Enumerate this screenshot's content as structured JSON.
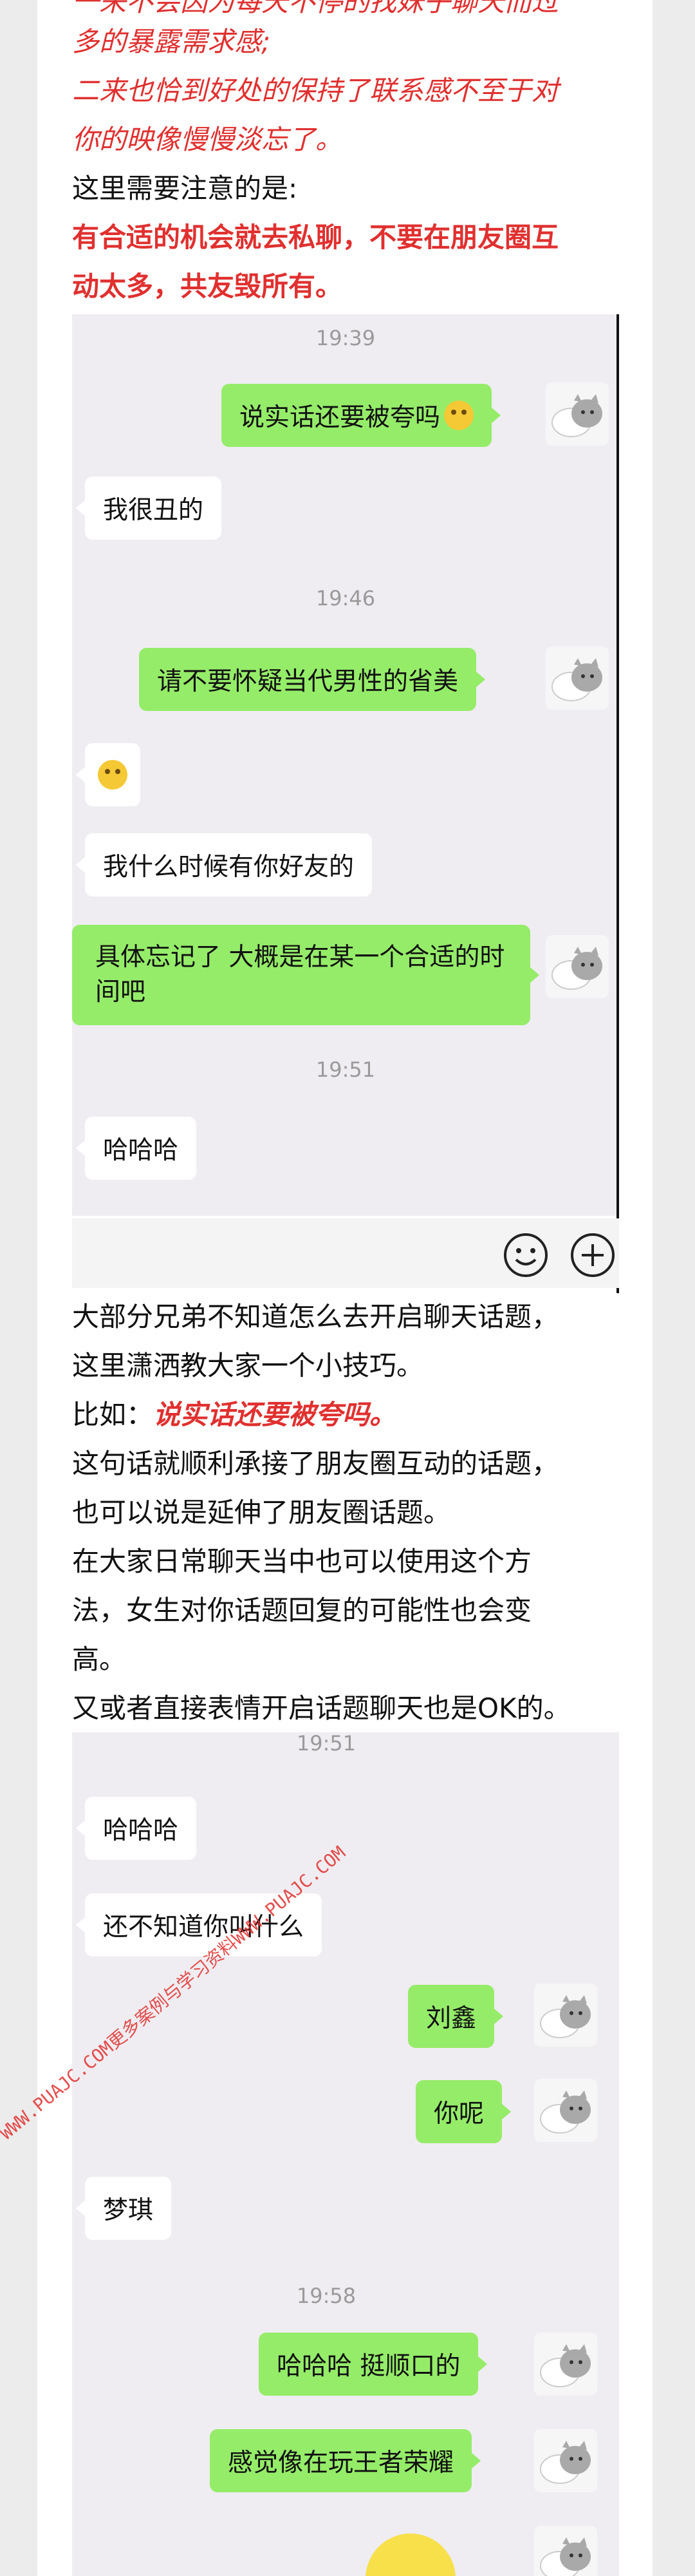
{
  "intro_lines": {
    "line1": "一来不会因为每天不停的找妹子聊天而过",
    "line2": "多的暴露需求感;",
    "line3": "二来也恰到好处的保持了联系感不至于对",
    "line4": "你的映像慢慢淡忘了。",
    "note": "这里需要注意的是:",
    "bold1": "有合适的机会就去私聊，不要在朋友圈互",
    "bold2": "动太多，共友毁所有。"
  },
  "chat1": {
    "ts1": "19:39",
    "m1": "说实话还要被夸吗",
    "m2": "我很丑的",
    "ts2": "19:46",
    "m3": "请不要怀疑当代男性的省美",
    "m5": "我什么时候有你好友的",
    "m6": "具体忘记了 大概是在某一个合适的时间吧",
    "ts3": "19:51",
    "m7": "哈哈哈"
  },
  "mid_text": {
    "p1": "大部分兄弟不知道怎么去开启聊天话题，",
    "p2": "这里潇洒教大家一个小技巧。",
    "p3_prefix": "比如：",
    "p3_quote": "说实话还要被夸吗。",
    "p4": "这句话就顺利承接了朋友圈互动的话题，",
    "p5": "也可以说是延伸了朋友圈话题。",
    "p6": "在大家日常聊天当中也可以使用这个方",
    "p7": "法，女生对你话题回复的可能性也会变",
    "p8": "高。",
    "p9": "又或者直接表情开启话题聊天也是OK的。"
  },
  "chat2": {
    "ts1": "19:51",
    "m1": "哈哈哈",
    "m2": "还不知道你叫什么",
    "m3": "刘鑫",
    "m4": "你呢",
    "m5": "梦琪",
    "ts2": "19:58",
    "m6": "哈哈哈 挺顺口的",
    "m7": "感觉像在玩王者荣耀"
  },
  "watermark": "WWW.PUAJC.COM更多案例与学习资料WWW.PUAJC.COM",
  "colors": {
    "accent_red": "#e0302f",
    "bubble_green": "#95ec69",
    "chat_bg": "#efedf1"
  }
}
